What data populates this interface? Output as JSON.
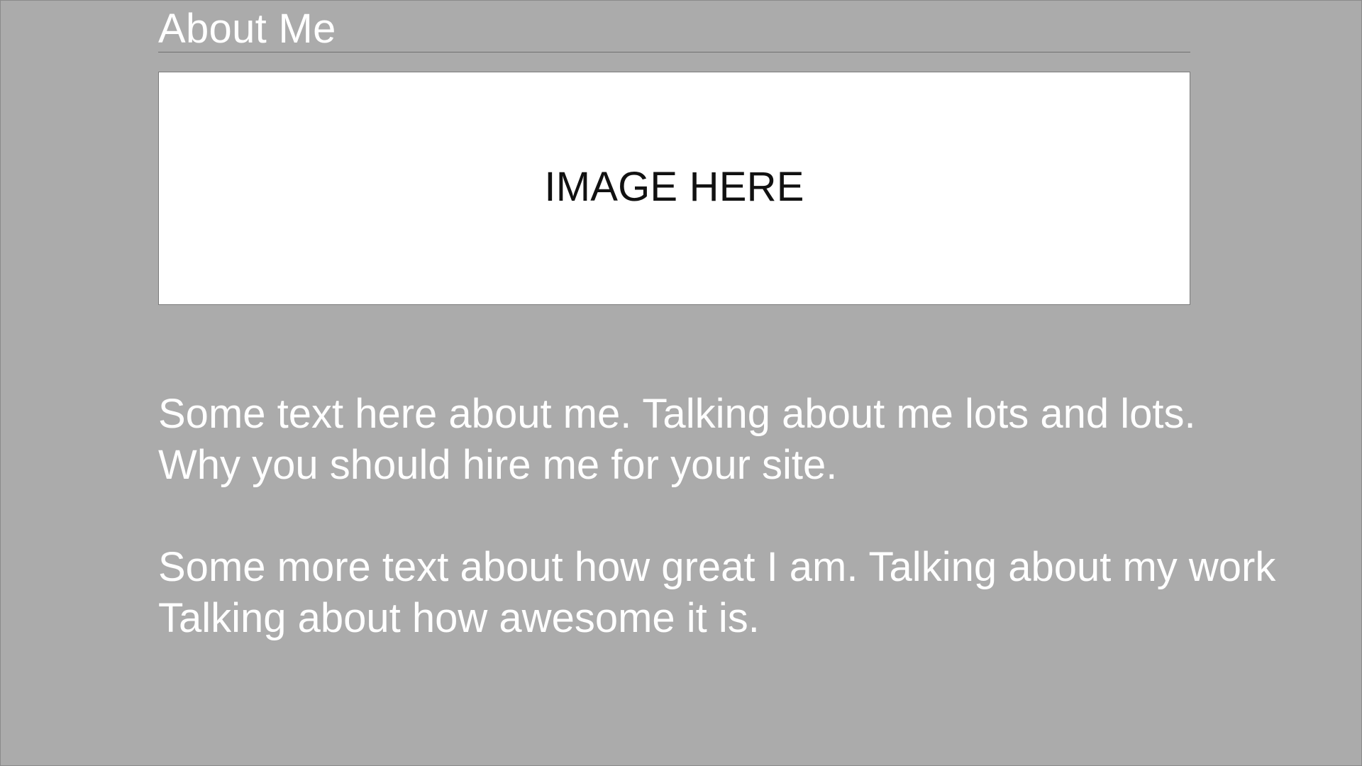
{
  "colors": {
    "background": "#ababab",
    "text_light": "#ffffff",
    "placeholder_bg": "#ffffff",
    "placeholder_text": "#111111"
  },
  "section": {
    "title": "About Me"
  },
  "image_placeholder": {
    "label": "IMAGE HERE"
  },
  "paragraphs": [
    {
      "lines": [
        "Some text here about me. Talking about me lots and lots.",
        "Why you should hire me for your site."
      ]
    },
    {
      "lines": [
        "Some more text about how great I am. Talking about my work",
        "Talking about how awesome it is."
      ]
    }
  ]
}
